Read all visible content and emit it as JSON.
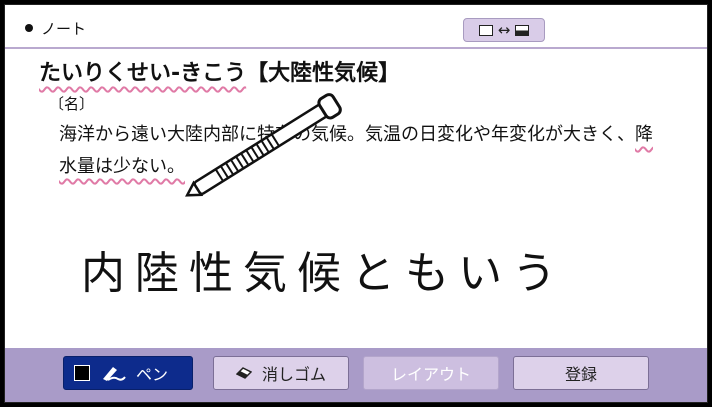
{
  "header": {
    "title": "ノート"
  },
  "entry": {
    "reading": "たいりくせい-きこう",
    "kanji": "【大陸性気候】",
    "pos": "〔名〕",
    "definition_line1_a": "海洋から遠い大陸内部に特有の気候。気温の日変化や年変化が大きく、",
    "definition_line1_b": "降",
    "definition_line2": "水量は少ない。"
  },
  "handwritten_note": "内陸性気候ともいう",
  "toolbar": {
    "pen_label": "ペン",
    "eraser_label": "消しゴム",
    "layout_label": "レイアウト",
    "register_label": "登録"
  },
  "colors": {
    "toolbar_bg": "#a99bc8",
    "pen_button_bg": "#0d2b8c",
    "wavy_underline": "#e07aa6"
  }
}
